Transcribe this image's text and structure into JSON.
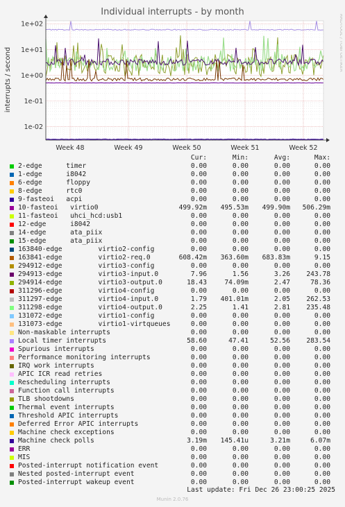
{
  "chart_data": {
    "type": "line",
    "title": "Individual interrupts - by month",
    "side_label": "RRDTOOL / TOBI OETIKER",
    "ylabel": "interrupts / second",
    "y_scale": "log",
    "ylim": [
      0.003,
      130
    ],
    "y_ticks": [
      "1e+02",
      "1e+01",
      "1e+00",
      "1e-01",
      "1e-02"
    ],
    "x_ticks": [
      "Week 48",
      "Week 49",
      "Week 50",
      "Week 51",
      "Week 52"
    ],
    "grid": true,
    "series_approx_levels": [
      {
        "name": "10-fasteoi   virtio0",
        "level": 0.49992,
        "color": "#660099"
      },
      {
        "name": "Local timer interrupts",
        "level": 58.6,
        "color": "#a68fe3"
      },
      {
        "name": "294914-edge         virtio3-output.0",
        "level": 2.47,
        "color": "#8fa030"
      },
      {
        "name": "163840-edge         virtio2-req.0",
        "level": 0.68383,
        "color": "#7a3b08"
      },
      {
        "name": "311298-edge         virtio4-output.0",
        "level": 2.81,
        "color": "#9dde8e"
      },
      {
        "name": "294913-edge         virtio3-input.0",
        "level": 3.26,
        "color": "#4d1470"
      },
      {
        "name": "Machine check polls",
        "level": 0.00321,
        "color": "#330099"
      }
    ]
  },
  "legend": {
    "headers": [
      "Cur:",
      "Min:",
      "Avg:",
      "Max:"
    ],
    "rows": [
      {
        "label": "2-edge      timer",
        "color": "#00cc00",
        "cur": "0.00",
        "min": "0.00",
        "avg": "0.00",
        "max": "0.00"
      },
      {
        "label": "1-edge      i8042",
        "color": "#0066b3",
        "cur": "0.00",
        "min": "0.00",
        "avg": "0.00",
        "max": "0.00"
      },
      {
        "label": "6-edge      floppy",
        "color": "#ff8000",
        "cur": "0.00",
        "min": "0.00",
        "avg": "0.00",
        "max": "0.00"
      },
      {
        "label": "8-edge      rtc0",
        "color": "#ffcc00",
        "cur": "0.00",
        "min": "0.00",
        "avg": "0.00",
        "max": "0.00"
      },
      {
        "label": "9-fasteoi   acpi",
        "color": "#330099",
        "cur": "0.00",
        "min": "0.00",
        "avg": "0.00",
        "max": "0.00"
      },
      {
        "label": "10-fasteoi   virtio0",
        "color": "#990099",
        "cur": "499.92m",
        "min": "495.53m",
        "avg": "499.90m",
        "max": "506.29m"
      },
      {
        "label": "11-fasteoi   uhci_hcd:usb1",
        "color": "#ccff00",
        "cur": "0.00",
        "min": "0.00",
        "avg": "0.00",
        "max": "0.00"
      },
      {
        "label": "12-edge      i8042",
        "color": "#ff0000",
        "cur": "0.00",
        "min": "0.00",
        "avg": "0.00",
        "max": "0.00"
      },
      {
        "label": "14-edge      ata_piix",
        "color": "#808080",
        "cur": "0.00",
        "min": "0.00",
        "avg": "0.00",
        "max": "0.00"
      },
      {
        "label": "15-edge      ata_piix",
        "color": "#008f00",
        "cur": "0.00",
        "min": "0.00",
        "avg": "0.00",
        "max": "0.00"
      },
      {
        "label": "163840-edge         virtio2-config",
        "color": "#00487d",
        "cur": "0.00",
        "min": "0.00",
        "avg": "0.00",
        "max": "0.00"
      },
      {
        "label": "163841-edge         virtio2-req.0",
        "color": "#b35a00",
        "cur": "608.42m",
        "min": "363.60m",
        "avg": "683.83m",
        "max": "9.15"
      },
      {
        "label": "294912-edge         virtio3-config",
        "color": "#b38f00",
        "cur": "0.00",
        "min": "0.00",
        "avg": "0.00",
        "max": "0.00"
      },
      {
        "label": "294913-edge         virtio3-input.0",
        "color": "#6b006b",
        "cur": "7.96",
        "min": "1.56",
        "avg": "3.26",
        "max": "243.78"
      },
      {
        "label": "294914-edge         virtio3-output.0",
        "color": "#8fb300",
        "cur": "18.43",
        "min": "74.09m",
        "avg": "2.47",
        "max": "78.36"
      },
      {
        "label": "311296-edge         virtio4-config",
        "color": "#b30000",
        "cur": "0.00",
        "min": "0.00",
        "avg": "0.00",
        "max": "0.00"
      },
      {
        "label": "311297-edge         virtio4-input.0",
        "color": "#bebebe",
        "cur": "1.79",
        "min": "401.01m",
        "avg": "2.05",
        "max": "262.53"
      },
      {
        "label": "311298-edge         virtio4-output.0",
        "color": "#80ff80",
        "cur": "2.25",
        "min": "1.41",
        "avg": "2.81",
        "max": "235.48"
      },
      {
        "label": "131072-edge         virtio1-config",
        "color": "#80c9ff",
        "cur": "0.00",
        "min": "0.00",
        "avg": "0.00",
        "max": "0.00"
      },
      {
        "label": "131073-edge         virtio1-virtqueues",
        "color": "#ffc080",
        "cur": "0.00",
        "min": "0.00",
        "avg": "0.00",
        "max": "0.00"
      },
      {
        "label": "Non-maskable interrupts",
        "color": "#ffe680",
        "cur": "0.00",
        "min": "0.00",
        "avg": "0.00",
        "max": "0.00"
      },
      {
        "label": "Local timer interrupts",
        "color": "#aa80ff",
        "cur": "58.60",
        "min": "47.41",
        "avg": "52.56",
        "max": "283.54"
      },
      {
        "label": "Spurious interrupts",
        "color": "#ee00cc",
        "cur": "0.00",
        "min": "0.00",
        "avg": "0.00",
        "max": "0.00"
      },
      {
        "label": "Performance monitoring interrupts",
        "color": "#ff8080",
        "cur": "0.00",
        "min": "0.00",
        "avg": "0.00",
        "max": "0.00"
      },
      {
        "label": "IRQ work interrupts",
        "color": "#666600",
        "cur": "0.00",
        "min": "0.00",
        "avg": "0.00",
        "max": "0.00"
      },
      {
        "label": "APIC ICR read retries",
        "color": "#ffbfff",
        "cur": "0.00",
        "min": "0.00",
        "avg": "0.00",
        "max": "0.00"
      },
      {
        "label": "Rescheduling interrupts",
        "color": "#00ffcc",
        "cur": "0.00",
        "min": "0.00",
        "avg": "0.00",
        "max": "0.00"
      },
      {
        "label": "Function call interrupts",
        "color": "#cc6699",
        "cur": "0.00",
        "min": "0.00",
        "avg": "0.00",
        "max": "0.00"
      },
      {
        "label": "TLB shootdowns",
        "color": "#999900",
        "cur": "0.00",
        "min": "0.00",
        "avg": "0.00",
        "max": "0.00"
      },
      {
        "label": "Thermal event interrupts",
        "color": "#00cc00",
        "cur": "0.00",
        "min": "0.00",
        "avg": "0.00",
        "max": "0.00"
      },
      {
        "label": "Threshold APIC interrupts",
        "color": "#0066b3",
        "cur": "0.00",
        "min": "0.00",
        "avg": "0.00",
        "max": "0.00"
      },
      {
        "label": "Deferred Error APIC interrupts",
        "color": "#ff8000",
        "cur": "0.00",
        "min": "0.00",
        "avg": "0.00",
        "max": "0.00"
      },
      {
        "label": "Machine check exceptions",
        "color": "#ffcc00",
        "cur": "0.00",
        "min": "0.00",
        "avg": "0.00",
        "max": "0.00"
      },
      {
        "label": "Machine check polls",
        "color": "#330099",
        "cur": "3.19m",
        "min": "145.41u",
        "avg": "3.21m",
        "max": "6.07m"
      },
      {
        "label": "ERR",
        "color": "#990099",
        "cur": "0.00",
        "min": "0.00",
        "avg": "0.00",
        "max": "0.00"
      },
      {
        "label": "MIS",
        "color": "#ccff00",
        "cur": "0.00",
        "min": "0.00",
        "avg": "0.00",
        "max": "0.00"
      },
      {
        "label": "Posted-interrupt notification event",
        "color": "#ff0000",
        "cur": "0.00",
        "min": "0.00",
        "avg": "0.00",
        "max": "0.00"
      },
      {
        "label": "Nested posted-interrupt event",
        "color": "#808080",
        "cur": "0.00",
        "min": "0.00",
        "avg": "0.00",
        "max": "0.00"
      },
      {
        "label": "Posted-interrupt wakeup event",
        "color": "#008f00",
        "cur": "0.00",
        "min": "0.00",
        "avg": "0.00",
        "max": "0.00"
      }
    ]
  },
  "footer": {
    "last_update": "Last update: Fri Dec 26 23:00:25 2025",
    "munin": "Munin 2.0.76"
  }
}
